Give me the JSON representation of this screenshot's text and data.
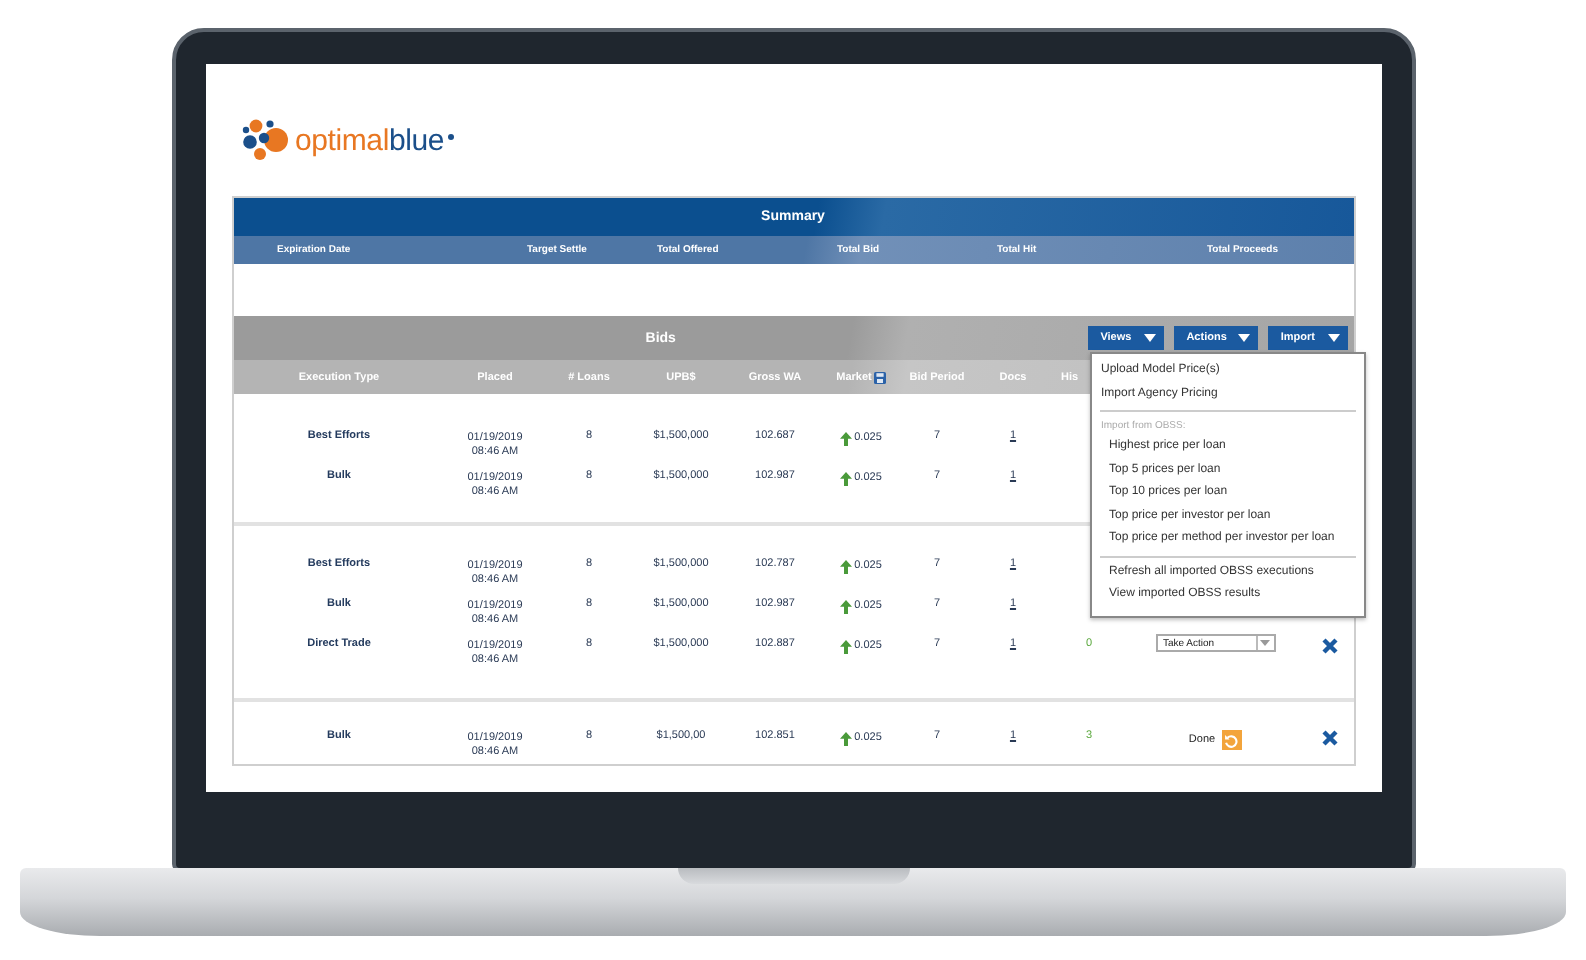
{
  "logo": {
    "parts": [
      {
        "text": "optimal",
        "color": "#e87722"
      },
      {
        "text": "blue",
        "color": "#1b4f8a"
      }
    ]
  },
  "summary": {
    "title": "Summary",
    "columns": [
      "Expiration Date",
      "Target Settle",
      "Total Offered",
      "Total Bid",
      "Total Hit",
      "Total Proceeds"
    ]
  },
  "bids": {
    "title": "Bids",
    "buttons": [
      "Views",
      "Actions",
      "Import"
    ],
    "columns": [
      {
        "label": "Execution Type"
      },
      {
        "label": "Placed"
      },
      {
        "label": "# Loans"
      },
      {
        "label": "UPB$"
      },
      {
        "label": "Gross WA"
      },
      {
        "label": "Market",
        "kind": "with_icon"
      },
      {
        "label": "Bid Period"
      },
      {
        "label": "Docs"
      },
      {
        "label": "His"
      }
    ],
    "groups": [
      {
        "rows": [
          {
            "execution_type": "Best Efforts",
            "placed_date": "01/19/2019",
            "placed_time": "08:46 AM",
            "loans": "8",
            "upb": "$1,500,000",
            "gross_wa": "102.687",
            "market_up": true,
            "market": "0.025",
            "bid_period": "7",
            "docs": "1"
          },
          {
            "execution_type": "Bulk",
            "placed_date": "01/19/2019",
            "placed_time": "08:46 AM",
            "loans": "8",
            "upb": "$1,500,000",
            "gross_wa": "102.987",
            "market_up": true,
            "market": "0.025",
            "bid_period": "7",
            "docs": "1"
          }
        ]
      },
      {
        "rows": [
          {
            "execution_type": "Best Efforts",
            "placed_date": "01/19/2019",
            "placed_time": "08:46 AM",
            "loans": "8",
            "upb": "$1,500,000",
            "gross_wa": "102.787",
            "market_up": true,
            "market": "0.025",
            "bid_period": "7",
            "docs": "1"
          },
          {
            "execution_type": "Bulk",
            "placed_date": "01/19/2019",
            "placed_time": "08:46 AM",
            "loans": "8",
            "upb": "$1,500,000",
            "gross_wa": "102.987",
            "market_up": true,
            "market": "0.025",
            "bid_period": "7",
            "docs": "1"
          },
          {
            "execution_type": "Direct Trade",
            "placed_date": "01/19/2019",
            "placed_time": "08:46 AM",
            "loans": "8",
            "upb": "$1,500,000",
            "gross_wa": "102.887",
            "market_up": true,
            "market": "0.025",
            "bid_period": "7",
            "docs": "1",
            "history": "0",
            "action": {
              "kind": "select",
              "value": "Take Action"
            },
            "deletable": true
          }
        ]
      },
      {
        "rows": [
          {
            "execution_type": "Bulk",
            "placed_date": "01/19/2019",
            "placed_time": "08:46 AM",
            "loans": "8",
            "upb": "$1,500,00",
            "gross_wa": "102.851",
            "market_up": true,
            "market": "0.025",
            "bid_period": "7",
            "docs": "1",
            "history": "3",
            "action": {
              "kind": "done",
              "label": "Done"
            },
            "deletable": true
          }
        ]
      }
    ]
  },
  "menu": {
    "items": [
      {
        "kind": "item",
        "label": "Upload Model Price(s)"
      },
      {
        "kind": "item",
        "label": "Import Agency Pricing"
      },
      {
        "kind": "divider"
      },
      {
        "kind": "heading",
        "label": "Import from OBSS:"
      },
      {
        "kind": "subitem",
        "label": "Highest price per loan"
      },
      {
        "kind": "subitem",
        "label": "Top 5 prices per loan"
      },
      {
        "kind": "subitem",
        "label": "Top 10 prices per loan"
      },
      {
        "kind": "subitem",
        "label": "Top price per investor per loan"
      },
      {
        "kind": "subitem",
        "label": "Top price per method per investor per loan"
      },
      {
        "kind": "divider"
      },
      {
        "kind": "subitem",
        "label": "Refresh all imported OBSS executions"
      },
      {
        "kind": "subitem",
        "label": "View imported OBSS results"
      }
    ]
  }
}
